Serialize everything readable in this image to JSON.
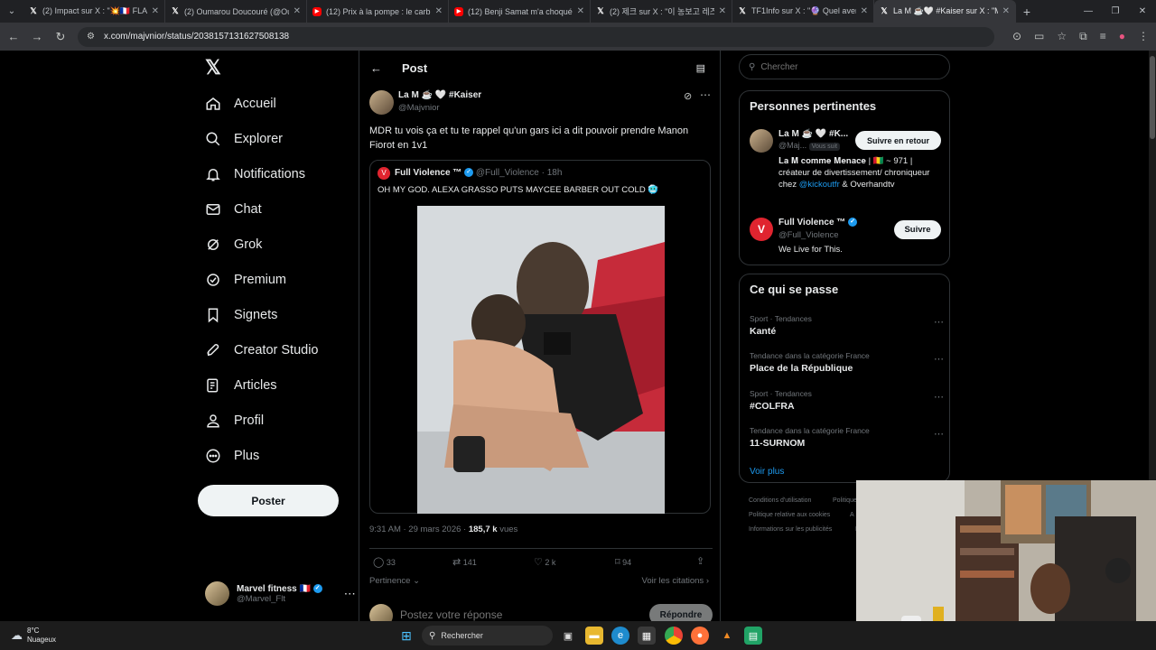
{
  "browser": {
    "tabs": [
      {
        "title": "(2) Impact sur X : \"💥🇫🇷 FLASH",
        "icon": "x-icon"
      },
      {
        "title": "(2) Oumarou Doucouré (@Oum",
        "icon": "x-icon"
      },
      {
        "title": "(12) Prix à la pompe : le carbur",
        "icon": "youtube-icon"
      },
      {
        "title": "(12) Benji Samat m'a choqué...",
        "icon": "youtube-icon"
      },
      {
        "title": "(2) 제크 sur X : \"이 농보고 레즈",
        "icon": "x-icon"
      },
      {
        "title": "TF1Info sur X : \"🔮 Quel avenir",
        "icon": "x-icon"
      },
      {
        "title": "La M ☕🤍 #Kaiser sur X : \"MD",
        "icon": "x-icon",
        "active": true
      }
    ],
    "url": "x.com/majvnior/status/2038157131627508138"
  },
  "nav": {
    "items": [
      {
        "label": "Accueil",
        "icon": "home-icon"
      },
      {
        "label": "Explorer",
        "icon": "search-icon"
      },
      {
        "label": "Notifications",
        "icon": "bell-icon"
      },
      {
        "label": "Chat",
        "icon": "mail-icon"
      },
      {
        "label": "Grok",
        "icon": "grok-icon"
      },
      {
        "label": "Premium",
        "icon": "premium-icon"
      },
      {
        "label": "Signets",
        "icon": "bookmark-icon"
      },
      {
        "label": "Creator Studio",
        "icon": "rocket-icon"
      },
      {
        "label": "Articles",
        "icon": "article-icon"
      },
      {
        "label": "Profil",
        "icon": "person-icon"
      },
      {
        "label": "Plus",
        "icon": "more-circle-icon"
      }
    ],
    "post_button": "Poster",
    "account": {
      "name": "Marvel fitness 🇫🇷",
      "handle": "@Marvel_Flt"
    }
  },
  "post": {
    "header_title": "Post",
    "author": {
      "name": "La M ☕ 🤍 #Kaiser",
      "handle": "@Majvnior"
    },
    "text": "MDR tu vois ça et tu te rappel qu'un gars ici a dit pouvoir prendre Manon Fiorot en 1v1",
    "quote": {
      "name": "Full Violence ™",
      "handle": "@Full_Violence",
      "time": "· 18h",
      "text": "OH MY GOD. ALEXA GRASSO PUTS MAYCEE BARBER OUT COLD 🥶"
    },
    "timestamp": "9:31 AM · 29 mars 2026 ·",
    "views_count": "185,7 k",
    "views_label": "vues",
    "stats": {
      "replies": "33",
      "reposts": "141",
      "likes": "2 k",
      "bookmarks": "94"
    },
    "sort_label": "Pertinence",
    "citations_link": "Voir les citations",
    "reply_placeholder": "Postez votre réponse",
    "reply_button": "Répondre"
  },
  "sidebar": {
    "search_placeholder": "Chercher",
    "relevant": {
      "title": "Personnes pertinentes",
      "people": [
        {
          "name": "La M ☕ 🤍 #K...",
          "handle": "@Maj...",
          "follows_you": "Vous suit",
          "button": "Suivre en retour",
          "bio_pre": "𝐋𝐚 𝐌 𝐜𝐨𝐦𝐦𝐞 𝐌𝐞𝐧𝐚𝐜𝐞 | 🇬🇳 ~ 971 | créateur de divertissement/ chroniqueur chez ",
          "bio_link": "@kickoutfr",
          "bio_post": " & Overhandtv"
        },
        {
          "name": "Full Violence ™",
          "handle": "@Full_Violence",
          "button": "Suivre",
          "bio": "We Live for This."
        }
      ]
    },
    "trends": {
      "title": "Ce qui se passe",
      "items": [
        {
          "meta": "Sport · Tendances",
          "name": "Kanté"
        },
        {
          "meta": "Tendance dans la catégorie France",
          "name": "Place de la République"
        },
        {
          "meta": "Sport · Tendances",
          "name": "#COLFRA"
        },
        {
          "meta": "Tendance dans la catégorie France",
          "name": "11-SURNOM"
        }
      ],
      "more": "Voir plus"
    },
    "footer": [
      "Conditions d'utilisation",
      "Politique",
      "Politique relative aux cookies",
      "A",
      "Informations sur les publicités",
      "P"
    ]
  },
  "taskbar": {
    "weather_temp": "8°C",
    "weather_desc": "Nuageux",
    "search": "Rechercher"
  }
}
